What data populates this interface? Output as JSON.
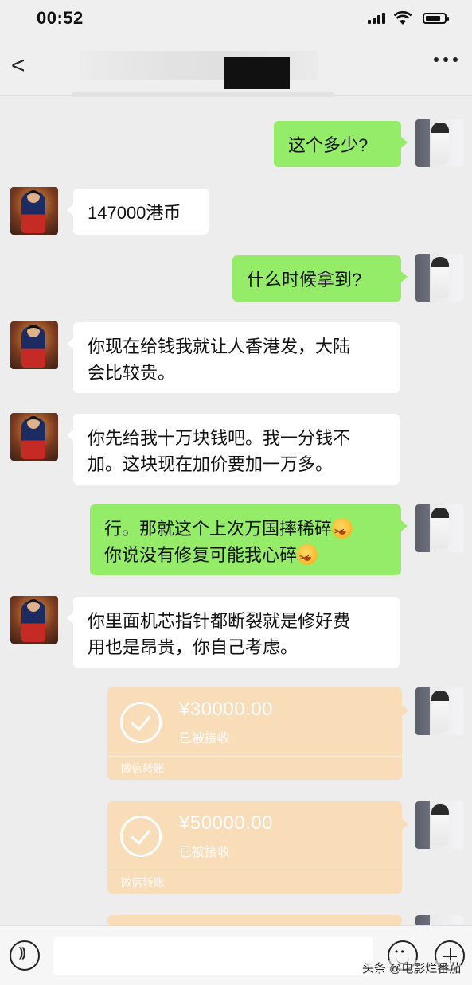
{
  "status_bar": {
    "time": "00:52"
  },
  "nav": {
    "back_symbol": "<",
    "more_symbol": "..."
  },
  "messages": [
    {
      "side": "out",
      "text": "这个多少?"
    },
    {
      "side": "in",
      "text": "147000港币"
    },
    {
      "side": "out",
      "text": "什么时候拿到?"
    },
    {
      "side": "in",
      "lines": [
        "你现在给钱我就让人香港发，大陆",
        "会比较贵。"
      ]
    },
    {
      "side": "in",
      "lines": [
        "你先给我十万块钱吧。我一分钱不",
        "加。这块现在加价要加一万多。"
      ]
    },
    {
      "side": "out",
      "lines": [
        "行。那就这个上次万国摔稀碎",
        "你说没有修复可能我心碎"
      ]
    },
    {
      "side": "in",
      "lines": [
        "你里面机芯指针都断裂就是修好费",
        "用也是昂贵，你自己考虑。"
      ]
    }
  ],
  "transfers": [
    {
      "amount": "¥30000.00",
      "status": "已被接收",
      "footer": "微信转账"
    },
    {
      "amount": "¥50000.00",
      "status": "已被接收",
      "footer": "微信转账"
    }
  ],
  "watermark": "头条 @电影烂番茄",
  "colors": {
    "outgoing_bubble": "#95ec69",
    "incoming_bubble": "#ffffff",
    "transfer_card": "#f9dcb8",
    "background": "#ededed"
  },
  "icons": [
    "back-icon",
    "more-icon",
    "voice-icon",
    "emoji-icon",
    "plus-icon"
  ]
}
